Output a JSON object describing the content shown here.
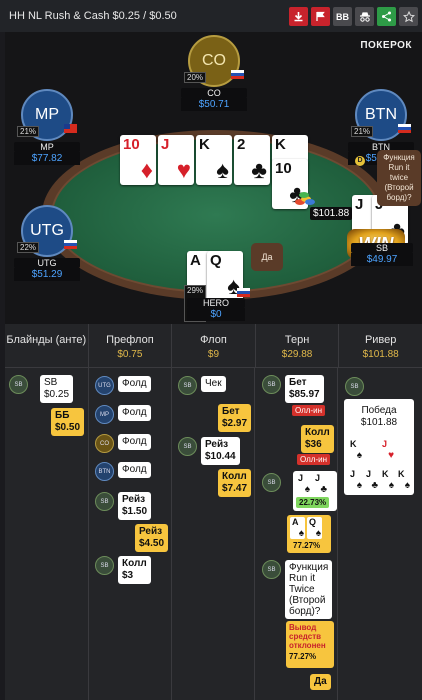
{
  "header": {
    "title": "HH NL Rush & Cash $0.25 / $0.50",
    "buttons": [
      {
        "icon": "download-icon",
        "color": "#c8232c"
      },
      {
        "icon": "flag-icon",
        "color": "#c8232c"
      },
      {
        "label": "BB",
        "color": "#4a4a4e"
      },
      {
        "icon": "incognito-icon",
        "color": "#4a4a4e"
      },
      {
        "icon": "share-icon",
        "color": "#2e9b47"
      },
      {
        "icon": "star-icon",
        "color": "#4a4a4e"
      }
    ]
  },
  "table": {
    "brand": "ПОКЕРОК",
    "seats": {
      "co": {
        "avatar": "CO",
        "pct": "20%",
        "name": "CO",
        "stack": "$50.71"
      },
      "mp": {
        "avatar": "MP",
        "pct": "21%",
        "name": "MP",
        "stack": "$77.82"
      },
      "btn": {
        "avatar": "BTN",
        "pct": "21%",
        "name": "BTN",
        "stack": "$52.73"
      },
      "utg": {
        "avatar": "UTG",
        "pct": "22%",
        "name": "UTG",
        "stack": "$51.29"
      },
      "sb": {
        "name": "SB",
        "stack": "$49.97",
        "badge": "WIN"
      },
      "hero": {
        "pct": "29%",
        "name": "HERO",
        "stack": "$0"
      }
    },
    "board": [
      {
        "rank": "10",
        "suit": "♦",
        "color": "red"
      },
      {
        "rank": "J",
        "suit": "♥",
        "color": "red"
      },
      {
        "rank": "K",
        "suit": "♠",
        "color": "blk"
      },
      {
        "rank": "2",
        "suit": "♣",
        "color": "blk"
      },
      {
        "rank": "K",
        "suit": "♠",
        "color": "blk"
      },
      {
        "rank": "10",
        "suit": "♣",
        "color": "blk"
      }
    ],
    "hero_cards": [
      {
        "rank": "A",
        "suit": "♠",
        "color": "blk"
      },
      {
        "rank": "Q",
        "suit": "♠",
        "color": "blk"
      }
    ],
    "sb_cards": [
      {
        "rank": "J",
        "suit": "♠",
        "color": "blk"
      },
      {
        "rank": "J",
        "suit": "♣",
        "color": "blk"
      }
    ],
    "pot": "$101.88",
    "dealer": "D",
    "bubble_sb": "Функция Run it twice (Второй борд)?",
    "bubble_hero": "Да"
  },
  "streets": [
    {
      "name": "Блайнды (анте)",
      "value": ""
    },
    {
      "name": "Префлоп",
      "value": "$0.75"
    },
    {
      "name": "Флоп",
      "value": "$9"
    },
    {
      "name": "Терн",
      "value": "$29.88"
    },
    {
      "name": "Ривер",
      "value": "$101.88"
    }
  ],
  "blinds": {
    "sb": "SB\n$0.25",
    "bb": "ББ\n$0.50"
  },
  "preflop": {
    "fold": "Фолд",
    "utg": "UTG",
    "mp": "MP",
    "co": "CO",
    "btn": "BTN",
    "sb": "SB",
    "raise1": "Рейз\n$1.50",
    "raise2": "Рейз\n$4.50",
    "call": "Колл\n$3"
  },
  "flop": {
    "check": "Чек",
    "bet": "Бет\n$2.97",
    "raise": "Рейз\n$10.44",
    "call": "Колл\n$7.47"
  },
  "turn": {
    "bet": "Бет\n$85.97",
    "allin": "Олл-ин",
    "call": "Колл\n$36",
    "eq1": "22.73%",
    "eq2": "77.27%",
    "question": "Функция\nRun it\nTwice\n(Второй\nборд)?",
    "withdraw": "Вывод\nсредств\nотклонен",
    "eq3": "77.27%",
    "yes": "Да"
  },
  "river": {
    "win": "Победа\n$101.88"
  }
}
